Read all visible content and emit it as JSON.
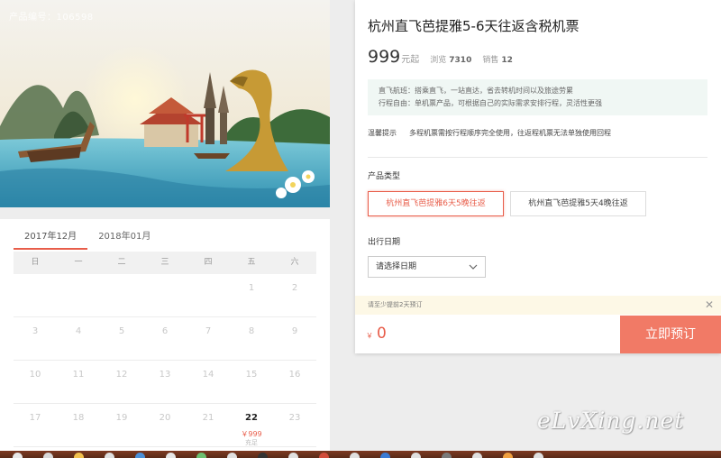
{
  "hero": {
    "product_code": "产品编号：106598"
  },
  "calendar": {
    "tabs": [
      {
        "label": "2017年12月",
        "active": true
      },
      {
        "label": "2018年01月",
        "active": false
      }
    ],
    "weekdays": [
      "日",
      "一",
      "二",
      "三",
      "四",
      "五",
      "六"
    ],
    "weeks": [
      [
        {
          "day": ""
        },
        {
          "day": ""
        },
        {
          "day": ""
        },
        {
          "day": ""
        },
        {
          "day": ""
        },
        {
          "day": "1"
        },
        {
          "day": "2"
        }
      ],
      [
        {
          "day": "3"
        },
        {
          "day": "4"
        },
        {
          "day": "5"
        },
        {
          "day": "6"
        },
        {
          "day": "7"
        },
        {
          "day": "8"
        },
        {
          "day": "9"
        }
      ],
      [
        {
          "day": "10"
        },
        {
          "day": "11"
        },
        {
          "day": "12"
        },
        {
          "day": "13"
        },
        {
          "day": "14"
        },
        {
          "day": "15"
        },
        {
          "day": "16"
        }
      ],
      [
        {
          "day": "17"
        },
        {
          "day": "18"
        },
        {
          "day": "19"
        },
        {
          "day": "20"
        },
        {
          "day": "21"
        },
        {
          "day": "22",
          "price": "￥999",
          "stock": "充足",
          "available": true
        },
        {
          "day": "23"
        }
      ]
    ]
  },
  "product": {
    "title": "杭州直飞芭提雅5-6天往返含税机票",
    "price": "999",
    "price_unit": "元起",
    "views_label": "浏览",
    "views": "7310",
    "sales_label": "销售",
    "sales": "12",
    "features": [
      "直飞航班：搭乘直飞，一站直达，省去转机时间以及旅途劳累",
      "行程自由：单机票产品，可根据自己的实际需求安排行程，灵活性更强"
    ],
    "tip_label": "温馨提示",
    "tip_text": "多程机票需按行程顺序完全使用，往返程机票无法单独使用回程"
  },
  "booking": {
    "type_label": "产品类型",
    "types": [
      {
        "label": "杭州直飞芭提雅6天5晚往返",
        "selected": true
      },
      {
        "label": "杭州直飞芭提雅5天4晚往返",
        "selected": false
      }
    ],
    "date_label": "出行日期",
    "date_placeholder": "请选择日期",
    "notice": "请至少提前2天预订",
    "notice_close": "✕",
    "total_currency": "￥",
    "total": "0",
    "book_button": "立即预订"
  },
  "watermark": "eLvXing.net",
  "colors": {
    "accent": "#e85d4a",
    "book_button": "#f17a66",
    "feature_bg": "#f0f7f4",
    "notice_bg": "#fdf8e6"
  }
}
